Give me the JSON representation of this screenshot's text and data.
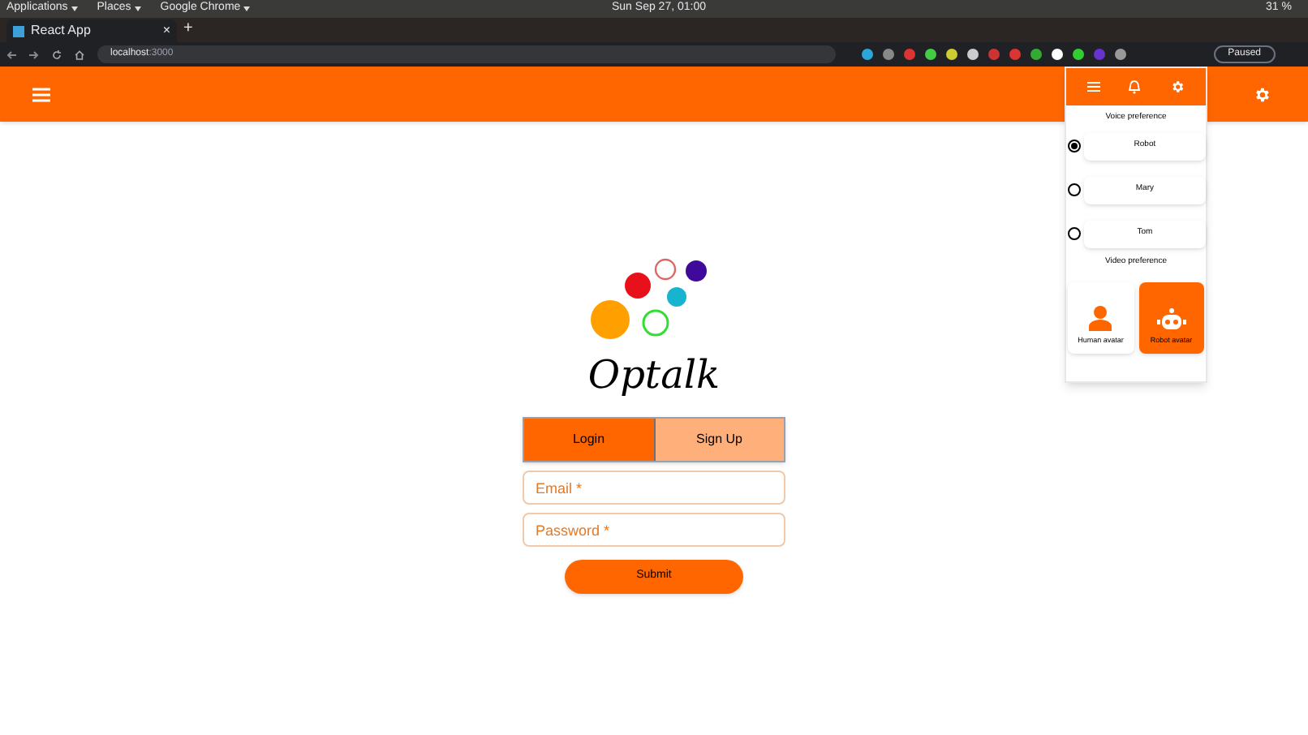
{
  "system_bar": {
    "menus": [
      "Applications",
      "Places",
      "Google Chrome"
    ],
    "clock": "Sun Sep 27, 01:00",
    "battery": "31 %"
  },
  "browser": {
    "tab_title": "React App",
    "tab_close": "×",
    "new_tab": "+",
    "url_host": "localhost",
    "url_port": ":3000",
    "profile": "Paused"
  },
  "logo": {
    "title": "Optalk"
  },
  "auth_tabs": [
    {
      "label": "Login",
      "selected": true
    },
    {
      "label": "Sign Up",
      "selected": false
    }
  ],
  "fields": [
    {
      "placeholder": "Email *"
    },
    {
      "placeholder": "Password *"
    }
  ],
  "submit": "Submit",
  "panel": {
    "voice_heading": "Voice preference",
    "voices": [
      {
        "label": "Robot",
        "selected": true
      },
      {
        "label": "Mary",
        "selected": false
      },
      {
        "label": "Tom",
        "selected": false
      }
    ],
    "video_heading": "Video preference",
    "avatars": [
      {
        "kind": "human",
        "label": "Human avatar",
        "selected": false
      },
      {
        "kind": "robot",
        "label": "Robot avatar",
        "selected": true
      }
    ]
  }
}
